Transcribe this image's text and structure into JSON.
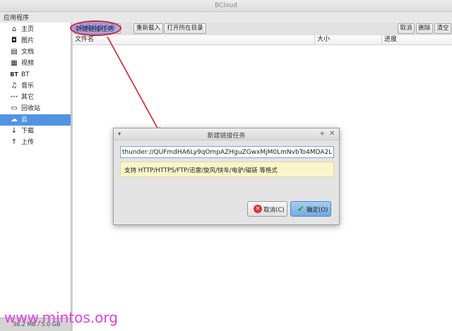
{
  "window": {
    "title": "BCloud"
  },
  "menu": {
    "app_menu": "应用程序"
  },
  "sidebar": {
    "items": [
      {
        "label": "主页",
        "icon": "home-icon",
        "glyph": "⌂"
      },
      {
        "label": "图片",
        "icon": "camera-icon",
        "glyph": "◘"
      },
      {
        "label": "文档",
        "icon": "document-icon",
        "glyph": "▤"
      },
      {
        "label": "视频",
        "icon": "film-icon",
        "glyph": "▦"
      },
      {
        "label": "BT",
        "icon": "bt-icon",
        "glyph": "BT"
      },
      {
        "label": "音乐",
        "icon": "music-note-icon",
        "glyph": "♫"
      },
      {
        "label": "其它",
        "icon": "more-dots-icon",
        "glyph": "•••"
      },
      {
        "label": "回收站",
        "icon": "trash-icon",
        "glyph": "▭"
      },
      {
        "label": "云",
        "icon": "cloud-icon",
        "glyph": "☁"
      },
      {
        "label": "下载",
        "icon": "download-icon",
        "glyph": "↓"
      },
      {
        "label": "上传",
        "icon": "upload-icon",
        "glyph": "↑"
      }
    ],
    "selected": "云",
    "quota": "36.2 MB / 5.0 GB"
  },
  "toolbar": {
    "new_link_task": "新建链接任务",
    "reload": "重新载入",
    "open_dir": "打开所在目录",
    "cancel": "取消",
    "delete": "删除",
    "clear": "清空"
  },
  "filelist": {
    "columns": [
      "文件名",
      "大小",
      "进度"
    ]
  },
  "dialog": {
    "title": "新建链接任务",
    "link_value": "thunder://QUFmdHA6Ly9qOmpAZHguZGwxMjM0LmNvbTo4MDA2L1QiV",
    "hint": "支持 HTTP/HTTPS/FTP/迅雷/旋风/快车/电驴/磁链 等格式",
    "cancel_label": "取消(C)",
    "ok_label": "确定(O)"
  },
  "colors": {
    "selection": "#5294e2",
    "annotation_red": "#d9202a",
    "hint_bg": "#fbf5c9",
    "watermark": "#e040e0"
  },
  "watermark": "www.mintos.org"
}
